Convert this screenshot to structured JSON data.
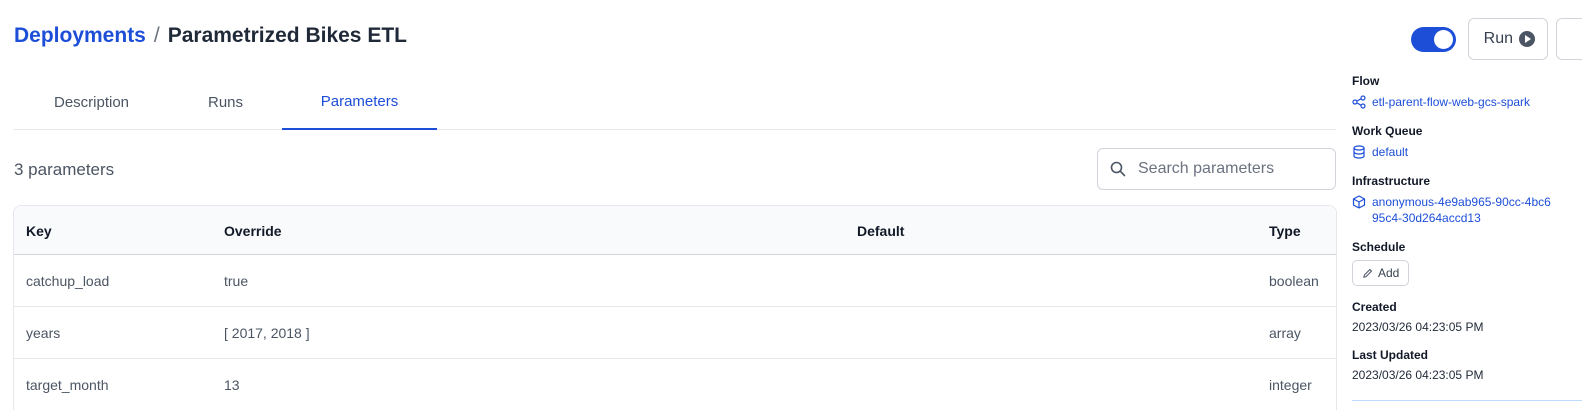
{
  "breadcrumb": {
    "root": "Deployments",
    "separator": "/",
    "current": "Parametrized Bikes ETL"
  },
  "actions": {
    "active_toggle_on": true,
    "run_label": "Run"
  },
  "tabs": [
    {
      "label": "Description",
      "active": false
    },
    {
      "label": "Runs",
      "active": false
    },
    {
      "label": "Parameters",
      "active": true
    }
  ],
  "parameters": {
    "count_text": "3 parameters",
    "search_placeholder": "Search parameters",
    "columns": [
      "Key",
      "Override",
      "Default",
      "Type"
    ],
    "rows": [
      {
        "key": "catchup_load",
        "override": "true",
        "default": "",
        "type": "boolean"
      },
      {
        "key": "years",
        "override": "[ 2017, 2018 ]",
        "default": "",
        "type": "array"
      },
      {
        "key": "target_month",
        "override": "13",
        "default": "",
        "type": "integer"
      }
    ]
  },
  "sidebar": {
    "flow": {
      "label": "Flow",
      "value": "etl-parent-flow-web-gcs-spark",
      "icon": "flow-icon"
    },
    "work_queue": {
      "label": "Work Queue",
      "value": "default",
      "icon": "database-icon"
    },
    "infrastructure": {
      "label": "Infrastructure",
      "value_line1": "anonymous-4e9ab965-90cc-4bc6",
      "value_line2": "95c4-30d264accd13",
      "icon": "cube-icon"
    },
    "schedule": {
      "label": "Schedule",
      "add_label": "Add",
      "icon": "pencil-icon"
    },
    "created": {
      "label": "Created",
      "value": "2023/03/26 04:23:05 PM"
    },
    "last_updated": {
      "label": "Last Updated",
      "value": "2023/03/26 04:23:05 PM"
    }
  },
  "colors": {
    "accent": "#1d4ed8",
    "border": "#d1d5db",
    "header_bg": "#f9fafb"
  }
}
